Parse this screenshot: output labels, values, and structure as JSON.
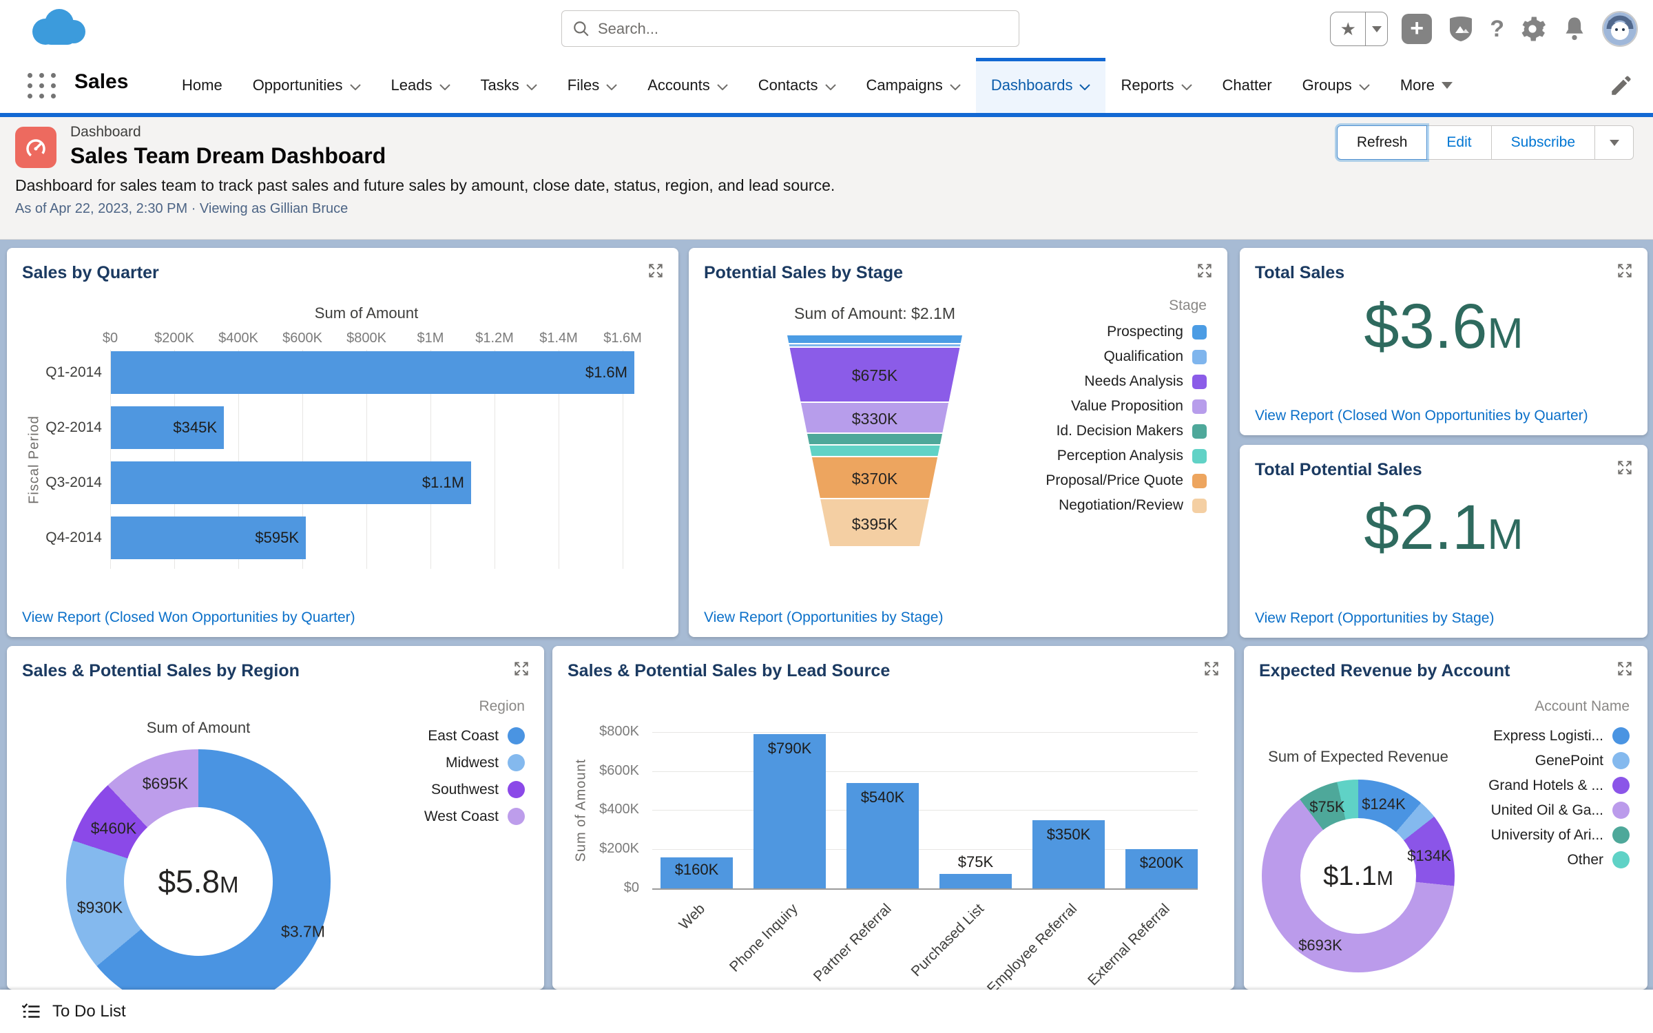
{
  "global_header": {
    "search": {
      "placeholder": "Search..."
    },
    "icons": {
      "favorites": "star",
      "global_actions": "plus",
      "guidance": "trailhead",
      "help": "question",
      "setup": "gear",
      "notifications": "bell",
      "profile": "astro-avatar"
    }
  },
  "nav": {
    "app_name": "Sales",
    "items": [
      {
        "label": "Home"
      },
      {
        "label": "Opportunities"
      },
      {
        "label": "Leads"
      },
      {
        "label": "Tasks"
      },
      {
        "label": "Files"
      },
      {
        "label": "Accounts"
      },
      {
        "label": "Contacts"
      },
      {
        "label": "Campaigns"
      },
      {
        "label": "Dashboards",
        "active": true
      },
      {
        "label": "Reports"
      },
      {
        "label": "Chatter"
      },
      {
        "label": "Groups"
      },
      {
        "label": "More"
      }
    ]
  },
  "page_header": {
    "record_type": "Dashboard",
    "title": "Sales Team Dream Dashboard",
    "description": "Dashboard for sales team to track past sales and future sales by amount, close date, status, region, and lead source.",
    "as_of": "As of Apr 22, 2023, 2:30 PM · Viewing as Gillian Bruce",
    "buttons": {
      "refresh": "Refresh",
      "edit": "Edit",
      "subscribe": "Subscribe"
    }
  },
  "chart_data": [
    {
      "id": "sales_by_quarter",
      "type": "bar",
      "orientation": "horizontal",
      "title": "Sales by Quarter",
      "axis_title": "Sum of Amount",
      "ylabel": "Fiscal Period",
      "categories": [
        "Q1-2014",
        "Q2-2014",
        "Q3-2014",
        "Q4-2014"
      ],
      "values": [
        1600000,
        345000,
        1100000,
        595000
      ],
      "value_labels": [
        "$1.6M",
        "$345K",
        "$1.1M",
        "$595K"
      ],
      "x_ticks": [
        "$0",
        "$200K",
        "$400K",
        "$600K",
        "$800K",
        "$1M",
        "$1.2M",
        "$1.4M",
        "$1.6M"
      ],
      "xlim": [
        0,
        1600000
      ],
      "grid": true,
      "bar_color": "#4f97e0",
      "link": "View Report (Closed Won Opportunities by Quarter)"
    },
    {
      "id": "potential_sales_by_stage",
      "type": "funnel",
      "title": "Potential Sales by Stage",
      "subtitle": "Sum of Amount: $2.1M",
      "legend_title": "Stage",
      "legend_position": "right",
      "stages": [
        {
          "label": "Prospecting",
          "color": "#4b9ce4",
          "value_label": ""
        },
        {
          "label": "Qualification",
          "color": "#7fb5ed",
          "value_label": ""
        },
        {
          "label": "Needs Analysis",
          "color": "#8b5ce8",
          "value_label": "$675K"
        },
        {
          "label": "Value Proposition",
          "color": "#b79deb",
          "value_label": "$330K"
        },
        {
          "label": "Id. Decision Makers",
          "color": "#4ea89a",
          "value_label": ""
        },
        {
          "label": "Perception Analysis",
          "color": "#61d2c6",
          "value_label": ""
        },
        {
          "label": "Proposal/Price Quote",
          "color": "#eda55f",
          "value_label": "$370K"
        },
        {
          "label": "Negotiation/Review",
          "color": "#f4cfa3",
          "value_label": "$395K"
        }
      ],
      "link": "View Report (Opportunities by Stage)"
    },
    {
      "id": "total_sales",
      "type": "metric",
      "title": "Total Sales",
      "value": "$3.6",
      "suffix": "M",
      "color": "#2e6a5e",
      "link": "View Report (Closed Won Opportunities by Quarter)"
    },
    {
      "id": "total_potential_sales",
      "type": "metric",
      "title": "Total Potential Sales",
      "value": "$2.1",
      "suffix": "M",
      "color": "#2e6a5e",
      "link": "View Report (Opportunities by Stage)"
    },
    {
      "id": "sales_by_region",
      "type": "donut",
      "title": "Sales & Potential Sales by Region",
      "subtitle": "Sum of Amount",
      "center_value": "$5.8",
      "center_suffix": "M",
      "legend_title": "Region",
      "legend_position": "right",
      "segments": [
        {
          "label": "East Coast",
          "color": "#4a94e2",
          "value_label": "$3.7M"
        },
        {
          "label": "Midwest",
          "color": "#84b9ee",
          "value_label": "$930K"
        },
        {
          "label": "Southwest",
          "color": "#8b49e8",
          "value_label": "$460K"
        },
        {
          "label": "West Coast",
          "color": "#bd9deb",
          "value_label": "$695K"
        }
      ]
    },
    {
      "id": "sales_by_lead_source",
      "type": "bar",
      "orientation": "vertical",
      "title": "Sales & Potential Sales by Lead Source",
      "ylabel": "Sum of Amount",
      "categories": [
        "Web",
        "Phone Inquiry",
        "Partner Referral",
        "Purchased List",
        "Employee Referral",
        "External Referral"
      ],
      "values": [
        160000,
        790000,
        540000,
        75000,
        350000,
        200000
      ],
      "value_labels": [
        "$160K",
        "$790K",
        "$540K",
        "$75K",
        "$350K",
        "$200K"
      ],
      "y_ticks": [
        "$800K",
        "$600K",
        "$400K",
        "$200K",
        "$0"
      ],
      "ylim": [
        0,
        800000
      ],
      "grid": true,
      "bar_color": "#4f97e0"
    },
    {
      "id": "expected_revenue_by_account",
      "type": "donut",
      "title": "Expected Revenue by Account",
      "subtitle": "Sum of Expected Revenue",
      "center_value": "$1.1",
      "center_suffix": "M",
      "legend_title": "Account Name",
      "legend_position": "right",
      "segments": [
        {
          "label": "Express Logisti...",
          "color": "#4a94e2",
          "value_label": "$124K"
        },
        {
          "label": "GenePoint",
          "color": "#84b9ee",
          "value_label": ""
        },
        {
          "label": "Grand Hotels & ...",
          "color": "#8b55e8",
          "value_label": "$134K"
        },
        {
          "label": "United Oil & Ga...",
          "color": "#bb9beb",
          "value_label": "$693K"
        },
        {
          "label": "University of Ari...",
          "color": "#4ea89a",
          "value_label": "$75K"
        },
        {
          "label": "Other",
          "color": "#5fd2c6",
          "value_label": ""
        }
      ]
    }
  ],
  "footer": {
    "todo": "To Do List"
  }
}
